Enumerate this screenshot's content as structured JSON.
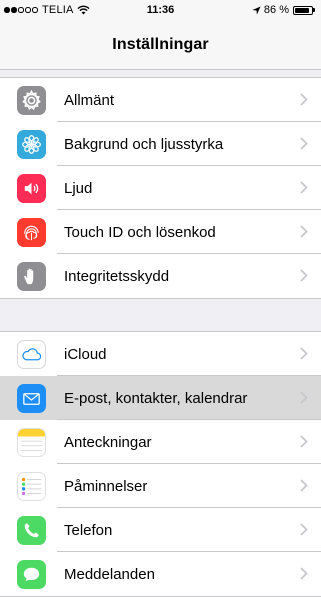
{
  "status_bar": {
    "signal_bars_filled": 2,
    "signal_bars_total": 5,
    "carrier": "TELIA",
    "time": "11:36",
    "battery_percent": "86 %",
    "battery_level": 0.86
  },
  "nav": {
    "title": "Inställningar"
  },
  "colors": {
    "chevron": "#c7c7cc",
    "highlight": "#d9d9d9",
    "separator": "#c8c7cc"
  },
  "settings": {
    "group1": [
      {
        "label": "Allmänt",
        "icon": "gear-icon",
        "color": "#8e8e93"
      },
      {
        "label": "Bakgrund och ljusstyrka",
        "icon": "flower-icon",
        "color": "#34aadc"
      },
      {
        "label": "Ljud",
        "icon": "speaker-icon",
        "color": "#ff2d55"
      },
      {
        "label": "Touch ID och lösenkod",
        "icon": "fingerprint-icon",
        "color": "#ff3b30"
      },
      {
        "label": "Integritetsskydd",
        "icon": "hand-icon",
        "color": "#8e8e93"
      }
    ],
    "group2": [
      {
        "label": "iCloud",
        "icon": "cloud-icon",
        "color": "#ffffff"
      },
      {
        "label": "E-post, kontakter, kalendrar",
        "icon": "mail-icon",
        "color": "#1d8ef5",
        "highlighted": true
      },
      {
        "label": "Anteckningar",
        "icon": "notes-icon",
        "color": "#ffd233"
      },
      {
        "label": "Påminnelser",
        "icon": "reminders-icon",
        "color": "#ffffff"
      },
      {
        "label": "Telefon",
        "icon": "phone-icon",
        "color": "#4cd964"
      },
      {
        "label": "Meddelanden",
        "icon": "messages-icon",
        "color": "#4cd964"
      }
    ]
  }
}
